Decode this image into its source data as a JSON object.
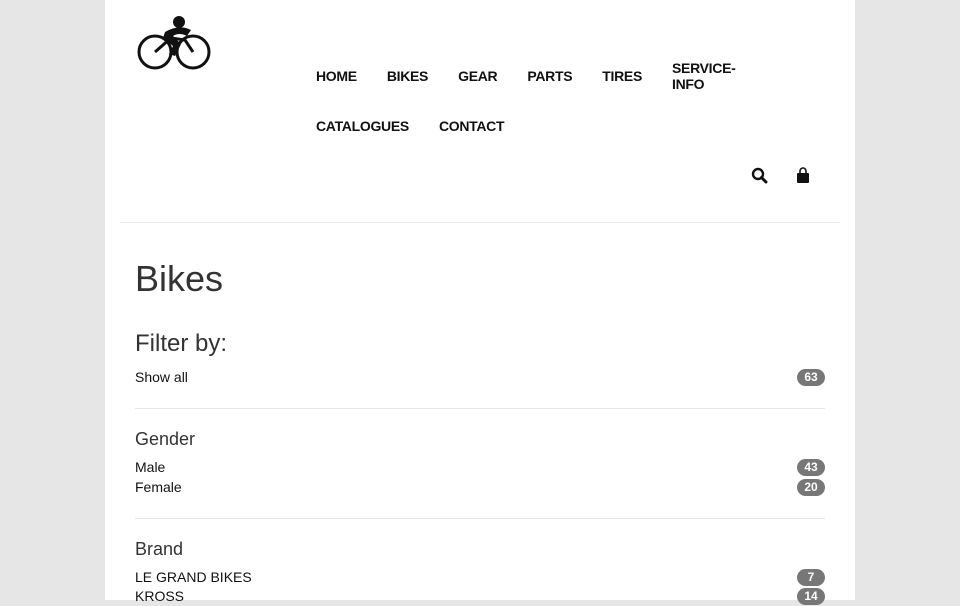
{
  "header": {
    "nav_row1": [
      "HOME",
      "BIKES",
      "GEAR",
      "PARTS",
      "TIRES",
      "SERVICE-INFO"
    ],
    "nav_row2": [
      "CATALOGUES",
      "CONTACT"
    ],
    "icons": {
      "logo": "cyclist-logo-icon",
      "search": "search-icon",
      "cart": "shopping-bag-icon"
    }
  },
  "main": {
    "title": "Bikes",
    "filter_heading": "Filter by:",
    "show_all": {
      "label": "Show all",
      "count": "63"
    },
    "gender": {
      "title": "Gender",
      "items": [
        {
          "label": "Male",
          "count": "43"
        },
        {
          "label": "Female",
          "count": "20"
        }
      ]
    },
    "brand": {
      "title": "Brand",
      "items": [
        {
          "label": "LE GRAND BIKES",
          "count": "7"
        },
        {
          "label": "KROSS",
          "count": "14"
        }
      ]
    }
  },
  "colors": {
    "page_bg": "#e6e6e6",
    "content_bg": "#ffffff",
    "badge_bg": "#777777"
  }
}
